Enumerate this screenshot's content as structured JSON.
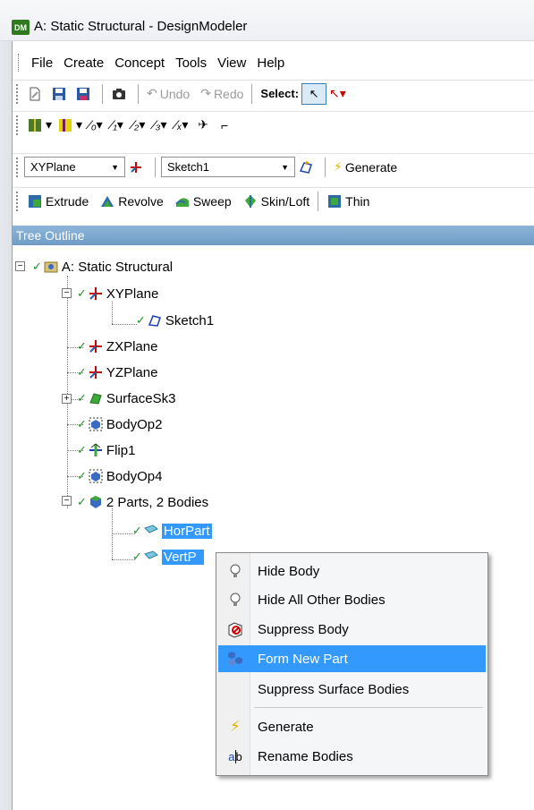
{
  "window": {
    "app_icon_text": "DM",
    "title": "A: Static Structural - DesignModeler"
  },
  "menu": [
    "File",
    "Create",
    "Concept",
    "Tools",
    "View",
    "Help"
  ],
  "toolbar1": {
    "undo": "Undo",
    "redo": "Redo",
    "select": "Select:"
  },
  "toolbar3": {
    "plane": "XYPlane",
    "sketch": "Sketch1",
    "generate": "Generate"
  },
  "toolbar4": {
    "extrude": "Extrude",
    "revolve": "Revolve",
    "sweep": "Sweep",
    "skinloft": "Skin/Loft",
    "thin": "Thin"
  },
  "tree": {
    "header": "Tree Outline",
    "nodes": [
      {
        "label": "A: Static Structural"
      },
      {
        "label": "XYPlane"
      },
      {
        "label": "Sketch1"
      },
      {
        "label": "ZXPlane"
      },
      {
        "label": "YZPlane"
      },
      {
        "label": "SurfaceSk3"
      },
      {
        "label": "BodyOp2"
      },
      {
        "label": "Flip1"
      },
      {
        "label": "BodyOp4"
      },
      {
        "label": "2 Parts, 2 Bodies"
      },
      {
        "label": "HorPart"
      },
      {
        "label": "VertP"
      }
    ]
  },
  "context_menu": {
    "items": [
      {
        "label": "Hide Body"
      },
      {
        "label": "Hide All Other Bodies"
      },
      {
        "label": "Suppress Body"
      },
      {
        "label": "Form New Part"
      },
      {
        "label": "Suppress Surface Bodies"
      },
      {
        "label": "Generate"
      },
      {
        "label": "Rename Bodies"
      }
    ],
    "highlighted": "Form New Part"
  },
  "colors": {
    "selection": "#3399ff",
    "check": "#2a8c2a",
    "tree_header": "#7ea9d0"
  }
}
